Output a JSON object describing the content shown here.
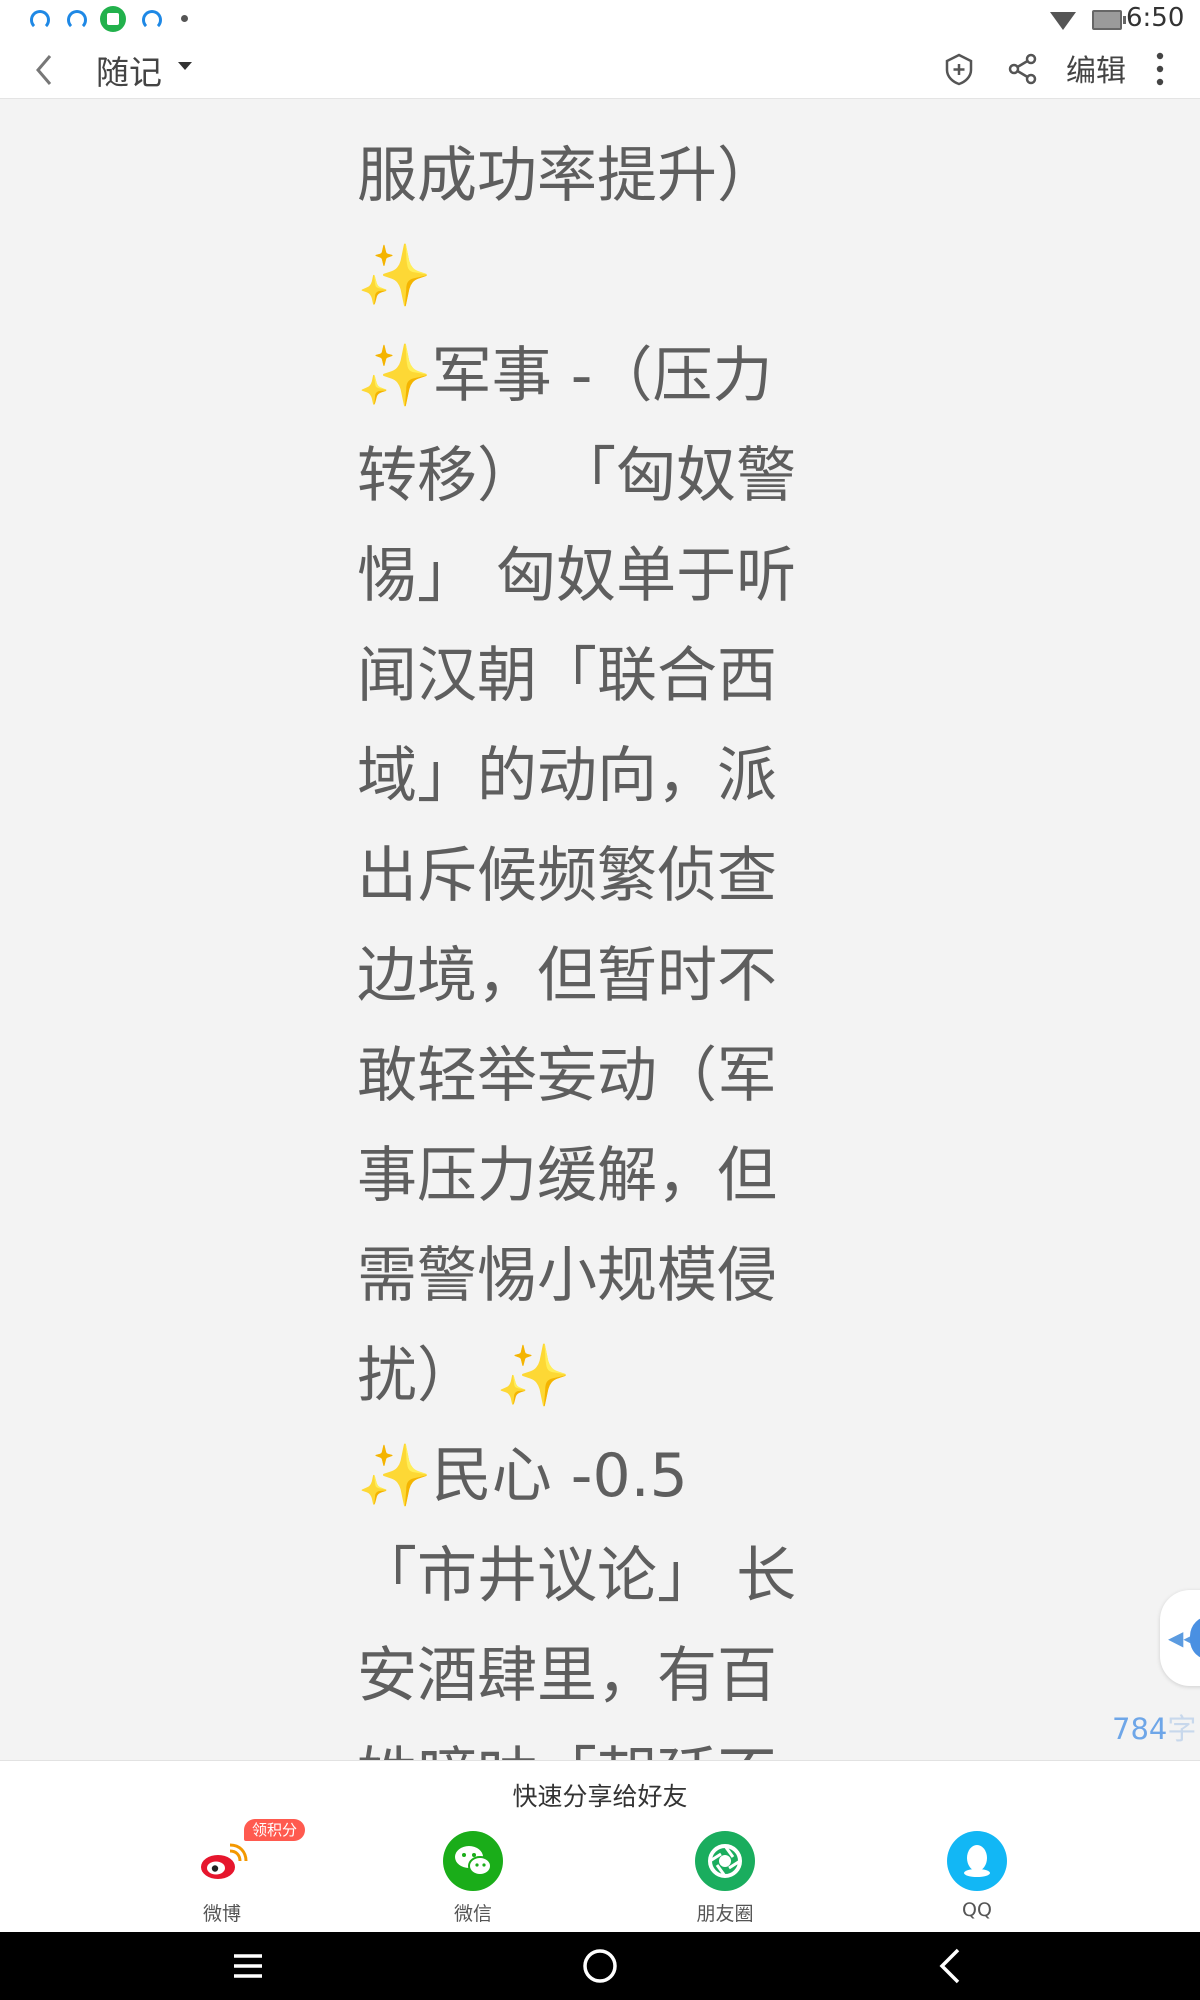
{
  "status_bar": {
    "time": "6:50",
    "icons": [
      "app-notification-icon",
      "app-notification-icon",
      "gallery-notification-icon",
      "app-notification-icon",
      "more-notifications-dot",
      "wifi-icon",
      "battery-icon"
    ]
  },
  "app_bar": {
    "title": "随记",
    "edit_label": "编辑",
    "icons": [
      "back-icon",
      "dropdown-caret-icon",
      "add-shield-icon",
      "share-icon",
      "more-vertical-icon"
    ]
  },
  "content": {
    "lines": [
      "服成功率提升）",
      "✨",
      "  ✨军事 -（压力",
      "转移）  「匈奴警",
      "惕」 匈奴单于听",
      "闻汉朝「联合西",
      "域」的动向，派",
      "出斥候频繁侦查",
      "边境，但暂时不",
      "敢轻举妄动（军",
      "事压力缓解，但",
      "需警惕小规模侵",
      "扰）  ✨",
      "  ✨民心 -0.5",
      "「市井议论」 长",
      "安酒肆里，有百",
      "姓嘀咕「朝廷不"
    ]
  },
  "word_count": {
    "value": "784",
    "unit": "字"
  },
  "share_bar": {
    "title": "快速分享给好友",
    "items": [
      {
        "label": "微博",
        "badge": "领积分",
        "icon": "weibo-icon",
        "color": "#e6162d"
      },
      {
        "label": "微信",
        "icon": "wechat-icon",
        "color": "#1aad19"
      },
      {
        "label": "朋友圈",
        "icon": "moments-icon",
        "color": "#1aad5e"
      },
      {
        "label": "QQ",
        "icon": "qq-icon",
        "color": "#12b7f5"
      }
    ]
  },
  "nav_bar": {
    "icons": [
      "recent-apps-icon",
      "home-icon",
      "back-nav-icon"
    ]
  }
}
